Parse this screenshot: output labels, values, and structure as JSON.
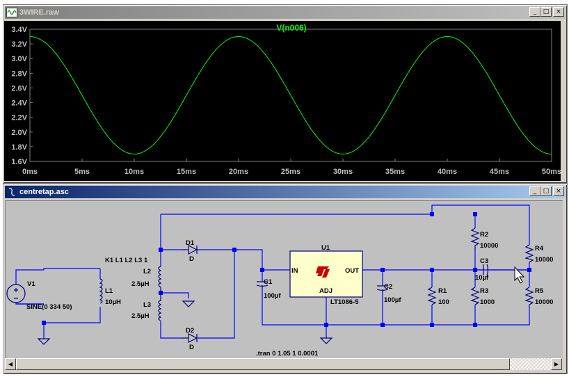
{
  "waveform_window": {
    "title": "3WIRE.raw",
    "buttons": {
      "minimize": "_",
      "maximize": "□",
      "close": "×"
    }
  },
  "schematic_window": {
    "title": "centretap.asc",
    "buttons": {
      "minimize": "_",
      "maximize": "□",
      "close": "×"
    }
  },
  "chart_data": {
    "type": "line",
    "title": "V(n006)",
    "series": [
      {
        "name": "V(n006)",
        "shape": "sine",
        "min": 1.7,
        "max": 3.3,
        "period_ms": 20,
        "peak_at_ms": [
          0,
          20,
          40
        ],
        "trough_at_ms": [
          10,
          30,
          50
        ]
      }
    ],
    "x_ticks": [
      "0ms",
      "5ms",
      "10ms",
      "15ms",
      "20ms",
      "25ms",
      "30ms",
      "35ms",
      "40ms",
      "45ms",
      "50ms"
    ],
    "y_ticks": [
      "3.4V",
      "3.2V",
      "3.0V",
      "2.8V",
      "2.6V",
      "2.4V",
      "2.2V",
      "2.0V",
      "1.8V",
      "1.6V"
    ],
    "xlim": [
      0,
      50
    ],
    "ylim": [
      1.6,
      3.4
    ],
    "background": "#000000",
    "trace_color": "#00ff00",
    "label_color": "#c0c0c0"
  },
  "schematic": {
    "components": {
      "V1": {
        "name": "V1",
        "value": "SINE(0 334 50)"
      },
      "L1": {
        "name": "L1",
        "value": "10µH"
      },
      "coupling": {
        "text": "K1 L1 L2 L3 1"
      },
      "L2": {
        "name": "L2",
        "value": "2.5µH"
      },
      "L3": {
        "name": "L3",
        "value": "2.5µH"
      },
      "D1": {
        "name": "D1",
        "value": "D"
      },
      "D2": {
        "name": "D2",
        "value": "D"
      },
      "C1": {
        "name": "C1",
        "value": "100µf"
      },
      "U1": {
        "name": "U1",
        "part": "LT1086-5",
        "pin_in": "IN",
        "pin_out": "OUT",
        "pin_adj": "ADJ"
      },
      "C2": {
        "name": "C2",
        "value": "100µf"
      },
      "R1": {
        "name": "R1",
        "value": "100"
      },
      "R2": {
        "name": "R2",
        "value": "10000"
      },
      "R3": {
        "name": "R3",
        "value": "1000"
      },
      "C3": {
        "name": "C3",
        "value": "10µf"
      },
      "R4": {
        "name": "R4",
        "value": "10000"
      },
      "R5": {
        "name": "R5",
        "value": "10000"
      }
    },
    "directive": ".tran 0 1.05 1 0.0001",
    "wire_color": "#0000ff",
    "component_color": "#000080",
    "logo_color": "#cc0000"
  }
}
